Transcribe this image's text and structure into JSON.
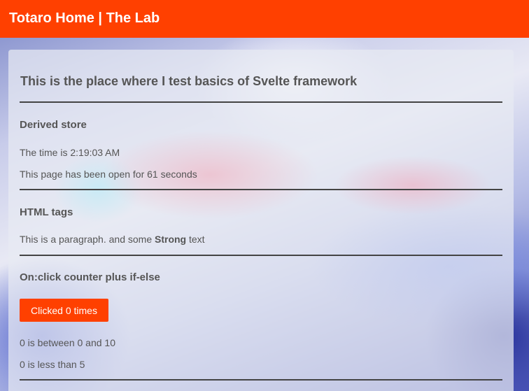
{
  "header": {
    "brand": "Totaro Home | The Lab"
  },
  "main": {
    "title": "This is the place where I test basics of Svelte framework",
    "derived_store": {
      "heading": "Derived store",
      "time_text": "The time is 2:19:03 AM",
      "open_text": "This page has been open for 61 seconds"
    },
    "html_tags": {
      "heading": "HTML tags",
      "text_before": "This is a paragraph. and some ",
      "strong_text": "Strong",
      "text_after": " text"
    },
    "counter": {
      "heading": "On:click counter plus if-else",
      "button_label": "Clicked 0 times",
      "range_text": "0 is between 0 and 10",
      "less_text": "0 is less than 5"
    }
  },
  "colors": {
    "accent": "#ff4000",
    "text": "#555555",
    "rule": "#444444"
  }
}
